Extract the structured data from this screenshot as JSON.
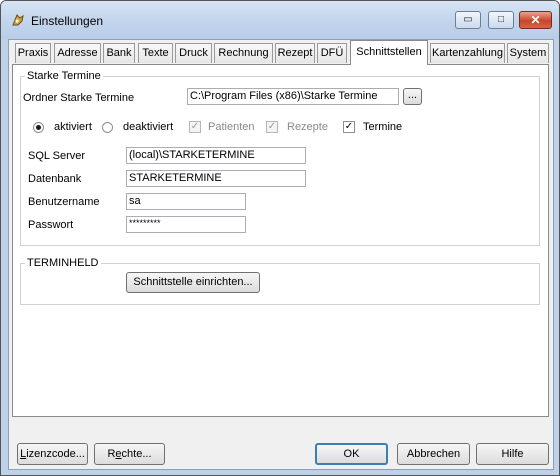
{
  "window": {
    "title": "Einstellungen",
    "minimize_glyph": "▭",
    "maximize_glyph": "□",
    "close_glyph": "✕"
  },
  "tabs": [
    {
      "label": "Praxis"
    },
    {
      "label": "Adresse"
    },
    {
      "label": "Bank"
    },
    {
      "label": "Texte"
    },
    {
      "label": "Druck"
    },
    {
      "label": "Rechnung"
    },
    {
      "label": "Rezept"
    },
    {
      "label": "DFÜ"
    },
    {
      "label": "Schnittstellen",
      "active": true
    },
    {
      "label": "Kartenzahlung"
    },
    {
      "label": "System"
    }
  ],
  "starke": {
    "group_title": "Starke Termine",
    "folder_label": "Ordner Starke Termine",
    "folder_value": "C:\\Program Files (x86)\\Starke Termine",
    "browse_label": "...",
    "radio_active": "aktiviert",
    "radio_inactive": "deaktiviert",
    "chk_patients": "Patienten",
    "chk_recipes": "Rezepte",
    "chk_dates": "Termine",
    "sql_label": "SQL Server",
    "sql_value": "(local)\\STARKETERMINE",
    "db_label": "Datenbank",
    "db_value": "STARKETERMINE",
    "user_label": "Benutzername",
    "user_value": "sa",
    "pw_label": "Passwort",
    "pw_value": "*********"
  },
  "terminheld": {
    "group_title": "TERMINHELD",
    "setup_button": "Schnittstelle einrichten..."
  },
  "footer": {
    "license_pre": "",
    "license_u": "L",
    "license_post": "izenzcode...",
    "rights_pre": "R",
    "rights_u": "e",
    "rights_post": "chte...",
    "ok": "OK",
    "cancel": "Abbrechen",
    "help": "Hilfe"
  },
  "colors": {
    "title_bar": "#c4d6ed",
    "close_button": "#c8452a",
    "dialog_bg": "#f0f0f0"
  }
}
